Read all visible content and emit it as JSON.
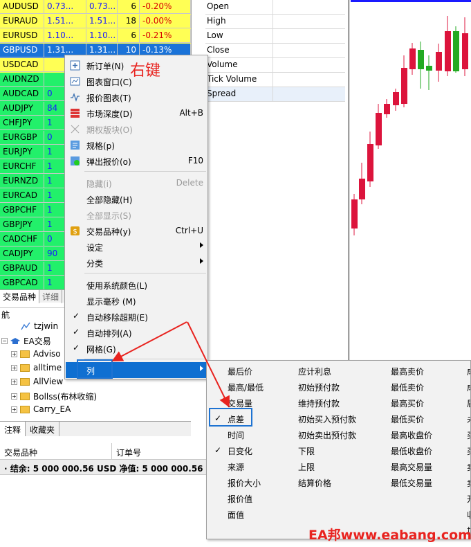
{
  "colors": {
    "row_yellow": "#ffff55",
    "row_green": "#22f06a",
    "row_selected": "#1a73d8",
    "negative": "#d80000",
    "menu_highlight": "#0f6fd1",
    "annotation": "#e8231f",
    "candle_red": "#dc143c",
    "candle_green": "#22aa22"
  },
  "market_watch": {
    "rows": [
      {
        "symbol": "AUDUSD",
        "bid": "0.73...",
        "ask": "0.73...",
        "ticks": "6",
        "change": "-0.20%",
        "bg": "yellow"
      },
      {
        "symbol": "EURAUD",
        "bid": "1.51...",
        "ask": "1.51...",
        "ticks": "18",
        "change": "-0.00%",
        "bg": "yellow"
      },
      {
        "symbol": "EURUSD",
        "bid": "1.10...",
        "ask": "1.10...",
        "ticks": "6",
        "change": "-0.21%",
        "bg": "yellow"
      },
      {
        "symbol": "GBPUSD",
        "bid": "1.31...",
        "ask": "1.31...",
        "ticks": "10",
        "change": "-0.13%",
        "bg": "selected"
      },
      {
        "symbol": "USDCAD",
        "bid": "",
        "ask": "",
        "ticks": "",
        "change": "",
        "bg": "yellow"
      },
      {
        "symbol": "AUDNZD",
        "bid": "",
        "ask": "",
        "ticks": "",
        "change": "",
        "bg": "green"
      },
      {
        "symbol": "AUDCAD",
        "bid": "0",
        "ask": "",
        "ticks": "",
        "change": "",
        "bg": "green"
      },
      {
        "symbol": "AUDJPY",
        "bid": "84",
        "ask": "",
        "ticks": "",
        "change": "",
        "bg": "green"
      },
      {
        "symbol": "CHFJPY",
        "bid": "1",
        "ask": "",
        "ticks": "",
        "change": "",
        "bg": "green"
      },
      {
        "symbol": "EURGBP",
        "bid": "0",
        "ask": "",
        "ticks": "",
        "change": "",
        "bg": "green"
      },
      {
        "symbol": "EURJPY",
        "bid": "1",
        "ask": "",
        "ticks": "",
        "change": "",
        "bg": "green"
      },
      {
        "symbol": "EURCHF",
        "bid": "1",
        "ask": "",
        "ticks": "",
        "change": "",
        "bg": "green"
      },
      {
        "symbol": "EURNZD",
        "bid": "1",
        "ask": "",
        "ticks": "",
        "change": "",
        "bg": "green"
      },
      {
        "symbol": "EURCAD",
        "bid": "1",
        "ask": "",
        "ticks": "",
        "change": "",
        "bg": "green"
      },
      {
        "symbol": "GBPCHF",
        "bid": "1",
        "ask": "",
        "ticks": "",
        "change": "",
        "bg": "green"
      },
      {
        "symbol": "GBPJPY",
        "bid": "1",
        "ask": "",
        "ticks": "",
        "change": "",
        "bg": "green"
      },
      {
        "symbol": "CADCHF",
        "bid": "0",
        "ask": "",
        "ticks": "",
        "change": "",
        "bg": "green"
      },
      {
        "symbol": "CADJPY",
        "bid": "90",
        "ask": "",
        "ticks": "",
        "change": "",
        "bg": "green"
      },
      {
        "symbol": "GBPAUD",
        "bid": "1",
        "ask": "",
        "ticks": "",
        "change": "",
        "bg": "green"
      },
      {
        "symbol": "GBPCAD",
        "bid": "1",
        "ask": "",
        "ticks": "",
        "change": "",
        "bg": "green"
      }
    ],
    "tabs": [
      "交易品种",
      "详细"
    ]
  },
  "navigator": {
    "title": "航",
    "items": {
      "script": "tzjwin ",
      "root": "EA交易",
      "f1": "Adviso",
      "f2": "alltime",
      "f3": "AllView",
      "f4": "Bollss(布林收缩)",
      "f5": "Carry_EA"
    },
    "tabs": [
      "注释",
      "收藏夹"
    ]
  },
  "data_window": {
    "rows": [
      "Open",
      "High",
      "Low",
      "Close",
      "Volume",
      "Tick Volume",
      "Spread"
    ]
  },
  "terminal": {
    "columns": [
      "交易品种",
      "订单号"
    ],
    "balance_text": "· 结余: 5 000 000.56 USD  净值: 5 000 000.56  可用"
  },
  "context_menu": {
    "new_order": "新订单(N)",
    "new_order_icon": "new-order-icon",
    "chart_window": "图表窗口(C)",
    "tick_chart": "报价图表(T)",
    "depth": "市场深度(D)",
    "depth_shortcut": "Alt+B",
    "options_board": "期权版块(O)",
    "specification": "规格(p)",
    "popup_prices": "弹出报价(o)",
    "popup_shortcut": "F10",
    "hide": "隐藏(i)",
    "hide_shortcut": "Delete",
    "hide_all": "全部隐藏(H)",
    "show_all": "全部显示(S)",
    "symbols": "交易品种(y)",
    "symbols_shortcut": "Ctrl+U",
    "sets": "设定",
    "sort": "分类",
    "system_colors": "使用系统颜色(L)",
    "milliseconds": "显示毫秒 (M)",
    "auto_remove": "自动移除超期(E)",
    "auto_arrange": "自动排列(A)",
    "grid": "网格(G)",
    "columns": "列"
  },
  "columns_submenu": {
    "col1": [
      "最后价",
      "最高/最低",
      "交易量",
      "点差",
      "时间",
      "日变化",
      "来源",
      "报价大小",
      "报价值",
      "面值"
    ],
    "col2": [
      "应计利息",
      "初始预付款",
      "维持预付款",
      "初始买入预付款",
      "初始卖出预付款",
      "下限",
      "上限",
      "结算价格"
    ],
    "col3": [
      "最高卖价",
      "最低卖价",
      "最高买价",
      "最低买价",
      "最高收盘价",
      "最低收盘价",
      "最高交易量",
      "最低交易量"
    ],
    "col4": [
      "成",
      "成",
      "届",
      "未",
      "买",
      "买",
      "卖",
      "卖",
      "开",
      "收",
      "加"
    ],
    "checked": [
      "点差",
      "日变化"
    ]
  },
  "annotations": {
    "right_click": "右键",
    "watermark": "EA邦www.eabang.com"
  }
}
